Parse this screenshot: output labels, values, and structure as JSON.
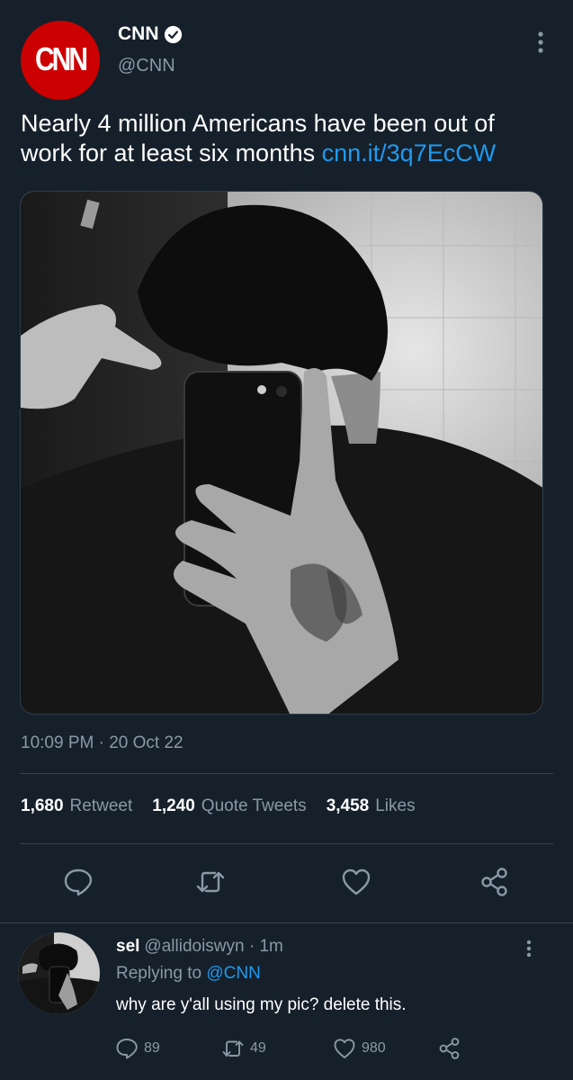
{
  "tweet": {
    "author_name": "CNN",
    "author_handle": "@CNN",
    "avatar_logo": "CNN",
    "text": "Nearly 4 million Americans have been out of work for at least six months ",
    "link": "cnn.it/3q7EcCW",
    "timestamp": "10:09 PM · 20 Oct 22",
    "stats": {
      "retweets_count": "1,680",
      "retweets_label": "Retweet",
      "quotes_count": "1,240",
      "quotes_label": "Quote Tweets",
      "likes_count": "3,458",
      "likes_label": "Likes"
    },
    "icons": {
      "verified": "verified-badge-icon",
      "more": "more-vertical-icon",
      "reply": "reply-icon",
      "retweet": "retweet-icon",
      "like": "heart-icon",
      "share": "share-icon"
    }
  },
  "reply": {
    "name": "sel",
    "handle": "@allidoiswyn",
    "time": "· 1m",
    "replying_prefix": "Replying to ",
    "replying_handle": "@CNN",
    "text": "why are y'all using my pic? delete this.",
    "reply_count": "89",
    "retweet_count": "49",
    "like_count": "980"
  },
  "colors": {
    "background": "#15202b",
    "link": "#1d9bf0",
    "secondary_text": "#8b98a5",
    "divider": "#38444d",
    "brand_red": "#cc0000"
  }
}
